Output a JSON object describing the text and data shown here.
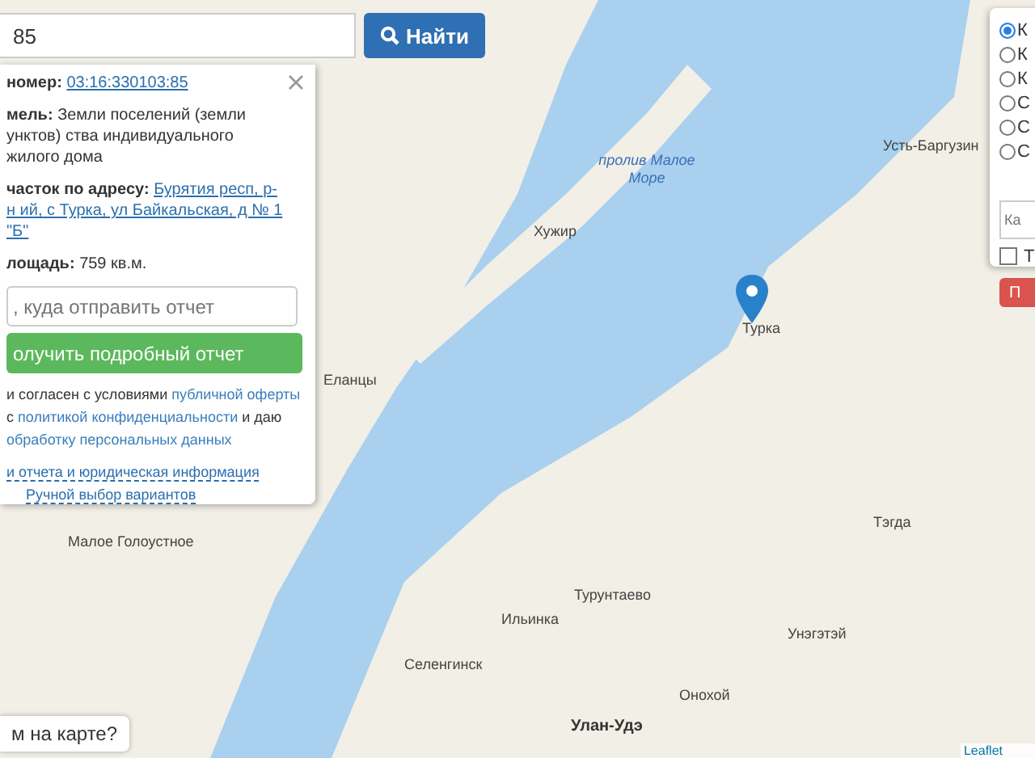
{
  "search": {
    "value": "85",
    "button": "Найти"
  },
  "info_panel": {
    "lines": [
      {
        "kind": "link",
        "label": "номер:",
        "text": "03:16:330103:85"
      },
      {
        "kind": "text",
        "label": "мель:",
        "text": "Земли поселений (земли унктов) ства индивидуального жилого дома"
      },
      {
        "kind": "link",
        "label": "часток по адресу:",
        "text": "Бурятия респ, р-н ий, с Турка, ул Байкальская, д № 1 \"Б\""
      },
      {
        "kind": "text",
        "label": "лощадь:",
        "text": "759 кв.м."
      }
    ],
    "email": {
      "placeholder": ", куда отправить отчет"
    },
    "report_button": "олучить подробный отчет",
    "consent": [
      {
        "text": "и согласен с условиями ",
        "link": "публичной оферты"
      },
      {
        "text": "с ",
        "link": "политикой конфиденциальности",
        "after": " и даю"
      },
      {
        "link": "обработку персональных данных"
      }
    ],
    "links": [
      "и отчета и юридическая информация",
      "Ручной выбор вариантов"
    ]
  },
  "help_button": "м на карте?",
  "options_panel": {
    "radios": [
      {
        "label": "К",
        "selected": true
      },
      {
        "label": "К",
        "selected": false
      },
      {
        "label": "К",
        "selected": false
      },
      {
        "label": "С",
        "selected": false
      },
      {
        "label": "С",
        "selected": false
      },
      {
        "label": "С",
        "selected": false
      }
    ],
    "input": {
      "placeholder": "Ка"
    },
    "checkbox": {
      "label": "Т",
      "checked": false
    },
    "button": "П"
  },
  "map": {
    "labels": [
      {
        "text": "Усть-Баргузин",
        "kind": "town"
      },
      {
        "text": "пролив Малое Море",
        "kind": "water"
      },
      {
        "text": "Хужир",
        "kind": "town"
      },
      {
        "text": "Турка",
        "kind": "town"
      },
      {
        "text": "Еланцы",
        "kind": "town"
      },
      {
        "text": "Тэгда",
        "kind": "town"
      },
      {
        "text": "Малое Голоустное",
        "kind": "town"
      },
      {
        "text": "Турунтаево",
        "kind": "town"
      },
      {
        "text": "Ильинка",
        "kind": "town"
      },
      {
        "text": "Унэгэтэй",
        "kind": "town"
      },
      {
        "text": "Селенгинск",
        "kind": "town"
      },
      {
        "text": "Онохой",
        "kind": "town"
      },
      {
        "text": "Улан-Удэ",
        "kind": "city"
      }
    ],
    "attribution": "Leaflet"
  }
}
